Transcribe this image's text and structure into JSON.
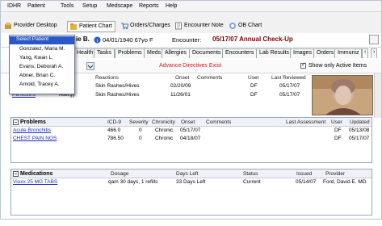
{
  "menu": [
    "IDHR",
    "Patient",
    "Tools",
    "Setup",
    "Medscape",
    "Reports",
    "Help"
  ],
  "toolbar": {
    "provider_desktop": "Provider Desktop",
    "patient_chart": "Patient Chart",
    "orders_charges": "Orders/Charges",
    "encounter_note": "Encounter Note",
    "ob_chart": "OB Chart"
  },
  "patient_bar": {
    "name_tail": "ie B.",
    "dob": "04/01/1940 67yo F",
    "encounter_label": "Encounter:",
    "encounter_value": "05/17/07 Annual Check-Up"
  },
  "patient_dropdown": {
    "items": [
      "Select Patient",
      "Gonzalez, Maria M.",
      "Yang, Kwan L.",
      "Evans, Deborah A.",
      "Abner, Brian C.",
      "Arnold, Tracey A."
    ]
  },
  "tabs": [
    "Health",
    "Tasks",
    "Problems",
    "Meds",
    "Allergies",
    "Documents",
    "Encounters",
    "Lab Results",
    "Images",
    "Orders",
    "Immuniz"
  ],
  "subbar": {
    "advance_directives": "Advance Directives Exist",
    "show_active": "Show only Active Items"
  },
  "allergies": {
    "headers": [
      "Reactions",
      "Onset",
      "Comments",
      "User",
      "Last Reviewed"
    ],
    "rows": [
      {
        "name": "",
        "type": "",
        "reaction": "Skin Rashes/Hives",
        "onset": "02/20/09",
        "comments": "",
        "user": "DF",
        "reviewed": "05/17/07"
      },
      {
        "name": "Penicillins",
        "type": "Allergy",
        "reaction": "Skin Rashes/Hives",
        "onset": "11/26/01",
        "comments": "",
        "user": "DF",
        "reviewed": "05/17/07"
      }
    ]
  },
  "problems": {
    "title": "Problems",
    "headers": [
      "ICD-9",
      "Severity",
      "Chronicity",
      "Onset",
      "Comments",
      "Last Assessment",
      "User",
      "Updated"
    ],
    "rows": [
      {
        "name": "Acute Bronchitis",
        "icd": "466.0",
        "severity": "0",
        "chronicity": "Chronic",
        "onset": "05/17/07",
        "comments": "",
        "last": "",
        "user": "DF",
        "updated": "05/13/08"
      },
      {
        "name": "CHEST PAIN NOS",
        "icd": "786.50",
        "severity": "0",
        "chronicity": "Chronic",
        "onset": "04/18/07",
        "comments": "",
        "last": "",
        "user": "DF",
        "updated": "05/17/07"
      }
    ]
  },
  "medications": {
    "title": "Medications",
    "headers": [
      "Dosage",
      "Days Left",
      "Status",
      "Issued",
      "Provider"
    ],
    "rows": [
      {
        "name": "Vioxx 25 MG TABS",
        "dosage": "qam 30 days, 1 refills",
        "days_left": "33 Days Left",
        "status": "Current",
        "issued": "05/14/07",
        "provider": "Ford, David E. MD"
      }
    ]
  },
  "colors": {
    "selection": "#2a58c9",
    "link": "#1a2fb8",
    "maroon": "#7a0000",
    "alert_red": "#d11b1b"
  }
}
